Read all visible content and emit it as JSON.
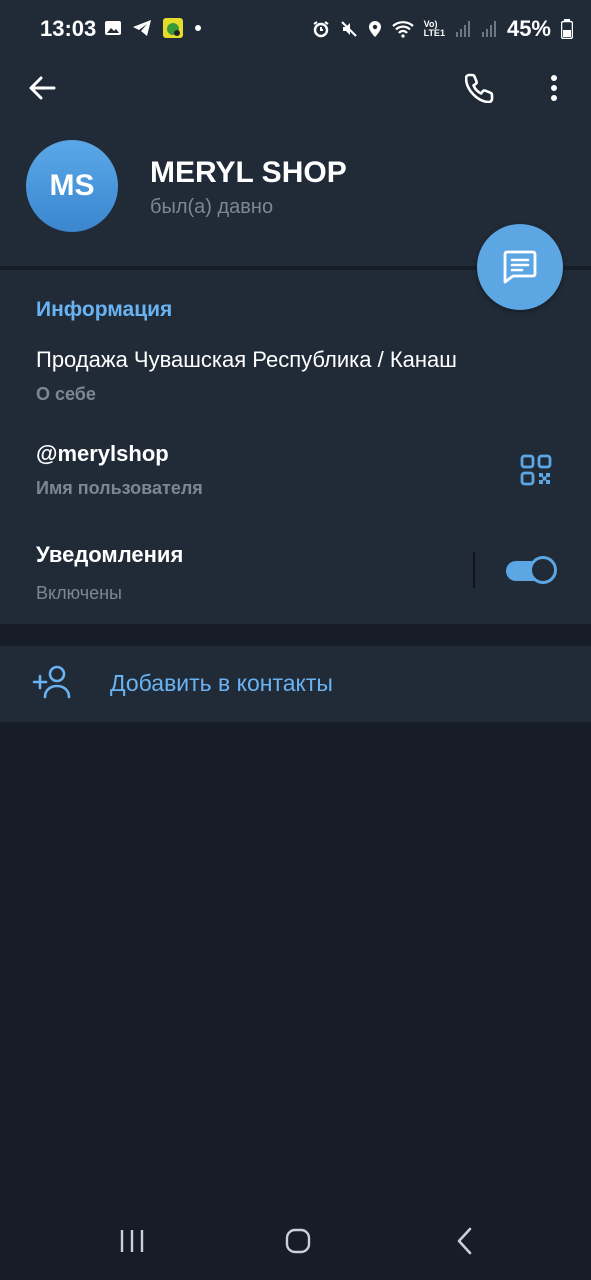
{
  "status_bar": {
    "time": "13:03",
    "battery_percent": "45%",
    "network_label_top": "Vo)",
    "network_label_bottom": "LTE1"
  },
  "header": {
    "avatar_initials": "MS",
    "name": "MERYL SHOP",
    "last_seen": "был(а) давно"
  },
  "info": {
    "section_title": "Информация",
    "bio_value": "Продажа Чувашская Республика / Канаш",
    "bio_label": "О себе",
    "username_value": "@merylshop",
    "username_label": "Имя пользователя",
    "notifications_label": "Уведомления",
    "notifications_status": "Включены",
    "notifications_enabled": true
  },
  "actions": {
    "add_contact_label": "Добавить в контакты"
  },
  "colors": {
    "accent": "#6ab3f3",
    "fab": "#5ca6e3",
    "surface": "#212b38",
    "background": "#171d27",
    "muted_text": "#7b8794"
  },
  "icons": [
    "back-arrow-icon",
    "phone-icon",
    "more-vert-icon",
    "message-icon",
    "qr-code-icon",
    "add-user-icon",
    "recents-icon",
    "home-icon",
    "nav-back-icon"
  ]
}
